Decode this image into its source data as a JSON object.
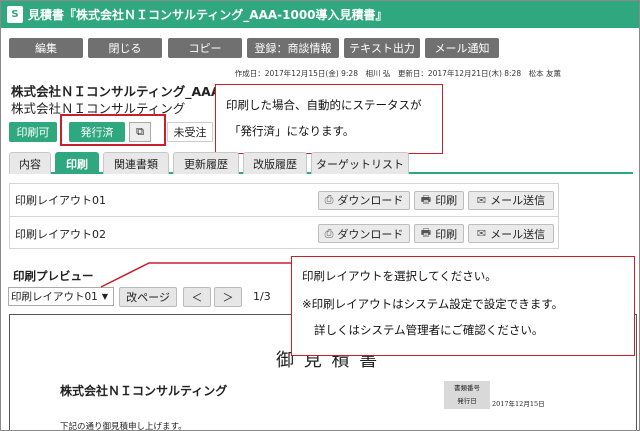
{
  "window": {
    "icon_label": "S",
    "title": "見積書『株式会社ＮＩコンサルティング_AAA-1000導入見積書』"
  },
  "toolbar": {
    "edit": "編集",
    "close": "閉じる",
    "copy": "コピー",
    "register": "登録：商談情報",
    "text_export": "テキスト出力",
    "mail_notify": "メール通知"
  },
  "meta": "作成日：2017年12月15日(金) 9:28　相川 弘　更新日：2017年12月21日(木) 8:28　松本 友薫",
  "record": {
    "company_bold": "株式会社ＮＩコンサルティング_AAA",
    "company_sub": "株式会社ＮＩコンサルティング"
  },
  "status": {
    "print_allowed": "印刷可",
    "issued": "発行済",
    "copy_icon": "⧉",
    "unordered": "未受注"
  },
  "callouts": {
    "top_line1": "印刷した場合、自動的にステータスが",
    "top_line2": "「発行済」になります。",
    "bottom_line1": "印刷レイアウトを選択してください。",
    "bottom_line2": "※印刷レイアウトはシステム設定で設定できます。",
    "bottom_line3": "詳しくはシステム管理者にご確認ください。"
  },
  "tabs": [
    "内容",
    "印刷",
    "関連書類",
    "更新履歴",
    "改版履歴",
    "ターゲットリスト"
  ],
  "layouts": {
    "row1": "印刷レイアウト01",
    "row2": "印刷レイアウト02",
    "download": "ダウンロード",
    "print": "印刷",
    "mail_send": "メール送信"
  },
  "preview": {
    "label": "印刷プレビュー",
    "selected": "印刷レイアウト01",
    "page_break": "改ページ",
    "prev": "＜",
    "next": "＞",
    "page_info": "1/3"
  },
  "document": {
    "title": "御 見 積 書",
    "company": "株式会社ＮＩコンサルティング",
    "note": "下記の通り御見積申し上げます。",
    "doc_no_label": "書類番号",
    "issue_date_label": "発行日",
    "issue_date": "2017年12月15日"
  },
  "colors": {
    "accent_green": "#2fa77f",
    "toolbar_gray": "#707070",
    "callout_red": "#c8202b"
  }
}
